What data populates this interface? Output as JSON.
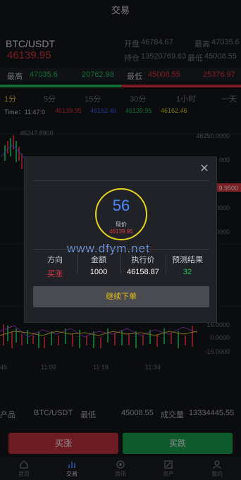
{
  "header": {
    "title": "交易"
  },
  "ticker": {
    "pair": "BTC/USDT",
    "price": "46139.95",
    "open_label": "开盘",
    "open_value": "46784.67",
    "high_label": "最高",
    "high_value": "47035.6",
    "position_label": "持仓",
    "position_value": "13520769.63",
    "low_label": "最低",
    "low_value": "45008.55"
  },
  "hl_row": {
    "high_label": "最高",
    "high_val": "47035.6",
    "high_vol": "20762.98",
    "low_label": "最低",
    "low_val": "45008.55",
    "low_vol": "25376.97"
  },
  "timeframes": [
    {
      "label": "1分",
      "active": true
    },
    {
      "label": "5分",
      "active": false
    },
    {
      "label": "15分",
      "active": false
    },
    {
      "label": "30分",
      "active": false
    },
    {
      "label": "1小时",
      "active": false
    },
    {
      "label": "一天",
      "active": false
    }
  ],
  "time_row": {
    "time": "Time：11:47:0",
    "v1": "46139.95",
    "v2": "46162.46",
    "v3": "46139.95",
    "v4": "46162.46"
  },
  "chart_data": {
    "type": "candlestick",
    "y_ticks": [
      "46250.0000",
      "46200.0000",
      "46150.0000",
      "46100.0000",
      "46050.0000"
    ],
    "y_ticks_visible": [
      "46250.0000",
      "000",
      "9.9500",
      "0000",
      "0000"
    ],
    "peak_label": "46247.8900",
    "x_ticks": [
      "46",
      "11:02",
      "11:18",
      "11:34"
    ],
    "macd_ticks": [
      "16.0000",
      "0.0000",
      "-16.0000"
    ]
  },
  "modal": {
    "countdown": "56",
    "current_price_label": "现价",
    "current_price": "46139.95",
    "watermark": "www.dfym.net",
    "columns": [
      {
        "header": "方向",
        "value": "买涨",
        "color": "#e0363f"
      },
      {
        "header": "金额",
        "value": "1000",
        "color": "#ffffff"
      },
      {
        "header": "执行价",
        "value": "46158.87",
        "color": "#ffffff"
      },
      {
        "header": "预测结果",
        "value": "32",
        "color": "#22c55e"
      }
    ],
    "continue_label": "继续下单"
  },
  "info_row": {
    "product_label": "产品",
    "product_value": "BTC/USDT",
    "low_label": "最低",
    "low_value": "45008.55",
    "volume_label": "成交量",
    "volume_value": "13334445.55"
  },
  "actions": {
    "buy_up": "买涨",
    "buy_down": "买跌"
  },
  "nav": [
    {
      "label": "首页",
      "icon": "home-icon"
    },
    {
      "label": "交易",
      "icon": "chart-icon"
    },
    {
      "label": "资讯",
      "icon": "news-icon"
    },
    {
      "label": "资产",
      "icon": "asset-icon"
    },
    {
      "label": "我的",
      "icon": "user-icon"
    }
  ],
  "colors": {
    "up": "#e0363f",
    "down": "#22c55e",
    "accent": "#e4c21a"
  }
}
